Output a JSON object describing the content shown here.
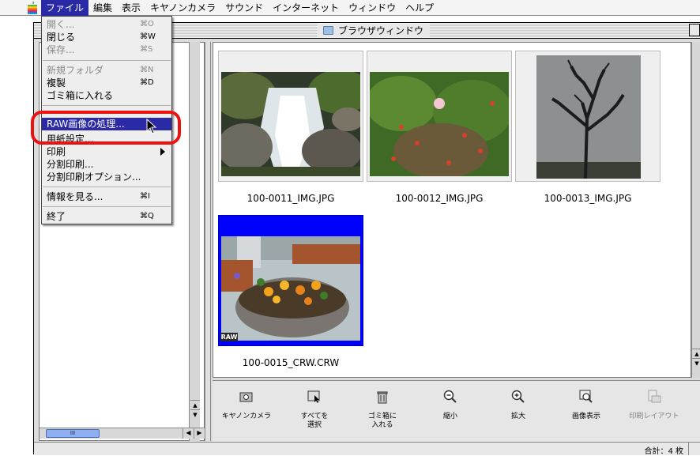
{
  "menubar": {
    "apple_icon": "apple-logo",
    "items": [
      "ファイル",
      "編集",
      "表示",
      "キヤノンカメラ",
      "サウンド",
      "インターネット",
      "ウィンドウ",
      "ヘルプ"
    ],
    "active_index": 0
  },
  "window": {
    "title": "ブラウザウィンドウ",
    "title_icon": "folder-icon",
    "right_glyph": "回日"
  },
  "file_menu": {
    "items": [
      {
        "label": "開く...",
        "shortcut": "⌘O",
        "enabled": false
      },
      {
        "label": "閉じる",
        "shortcut": "⌘W",
        "enabled": true
      },
      {
        "label": "保存...",
        "shortcut": "⌘S",
        "enabled": false
      },
      {
        "label": "新規フォルダ",
        "shortcut": "⌘N",
        "enabled": false
      },
      {
        "label": "複製",
        "shortcut": "⌘D",
        "enabled": true
      },
      {
        "label": "ゴミ箱に入れる",
        "shortcut": "",
        "enabled": true
      },
      {
        "label": "RAW画像の処理...",
        "shortcut": "",
        "enabled": true,
        "highlighted": true
      },
      {
        "label": "用紙設定...",
        "shortcut": "",
        "enabled": true
      },
      {
        "label": "印刷",
        "shortcut": "",
        "enabled": true,
        "submenu": true
      },
      {
        "label": "分割印刷...",
        "shortcut": "",
        "enabled": true
      },
      {
        "label": "分割印刷オプション...",
        "shortcut": "",
        "enabled": true
      },
      {
        "label": "情報を見る...",
        "shortcut": "⌘I",
        "enabled": true
      },
      {
        "label": "終了",
        "shortcut": "⌘Q",
        "enabled": true
      }
    ]
  },
  "thumbnails": [
    {
      "filename": "100-0011_IMG.JPG",
      "subject": "waterfall",
      "selected": false
    },
    {
      "filename": "100-0012_IMG.JPG",
      "subject": "flower-bush",
      "selected": false
    },
    {
      "filename": "100-0013_IMG.JPG",
      "subject": "bare-tree",
      "selected": false
    },
    {
      "filename": "100-0015_CRW.CRW",
      "subject": "flower-planter",
      "selected": true,
      "badge": "RAW"
    }
  ],
  "toolbar": {
    "buttons": [
      {
        "label": "キヤノンカメラ",
        "icon": "camera-icon",
        "enabled": true
      },
      {
        "label": "すべてを\n選択",
        "icon": "select-all-icon",
        "enabled": true
      },
      {
        "label": "ゴミ箱に\n入れる",
        "icon": "trash-icon",
        "enabled": true
      },
      {
        "label": "縮小",
        "icon": "zoom-out-icon",
        "enabled": true
      },
      {
        "label": "拡大",
        "icon": "zoom-in-icon",
        "enabled": true
      },
      {
        "label": "画像表示",
        "icon": "view-image-icon",
        "enabled": true
      },
      {
        "label": "印刷レイアウト",
        "icon": "print-layout-icon",
        "enabled": false
      }
    ]
  },
  "status": {
    "total": "合計：4 枚"
  },
  "scrollbar": {
    "thumb_glyph": "III"
  },
  "colors": {
    "menu_highlight": "#2a2aa6",
    "selection_blue": "#0000ff",
    "annotation_red": "#ee1111"
  }
}
